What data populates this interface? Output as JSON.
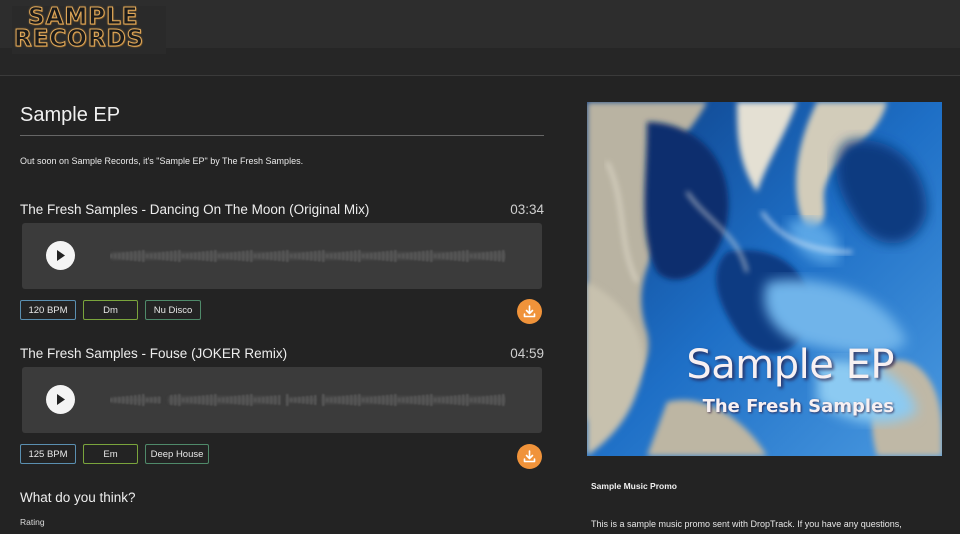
{
  "header": {
    "logo_line1": "SAMPLE",
    "logo_line2": "RECORDS"
  },
  "release": {
    "title": "Sample EP",
    "description": "Out soon on Sample Records, it's \"Sample EP\" by The Fresh Samples."
  },
  "tracks": [
    {
      "title": "The Fresh Samples - Dancing On The Moon (Original Mix)",
      "duration": "03:34",
      "bpm": "120 BPM",
      "key": "Dm",
      "genre": "Nu Disco"
    },
    {
      "title": "The Fresh Samples - Fouse (JOKER Remix)",
      "duration": "04:59",
      "bpm": "125 BPM",
      "key": "Em",
      "genre": "Deep House"
    }
  ],
  "feedback": {
    "heading": "What do you think?",
    "rating_label": "Rating"
  },
  "cover": {
    "title": "Sample EP",
    "artist": "The Fresh Samples"
  },
  "promo": {
    "title": "Sample Music Promo",
    "body": "This is a sample music promo sent with DropTrack. If you have any questions,"
  },
  "colors": {
    "accent_orange": "#f0933a",
    "bpm_border": "#5a8fb0",
    "key_border": "#7aa43c",
    "genre_border": "#4f8a6a",
    "background": "#232323"
  },
  "icons": {
    "play": "play-icon",
    "download": "download-icon"
  }
}
